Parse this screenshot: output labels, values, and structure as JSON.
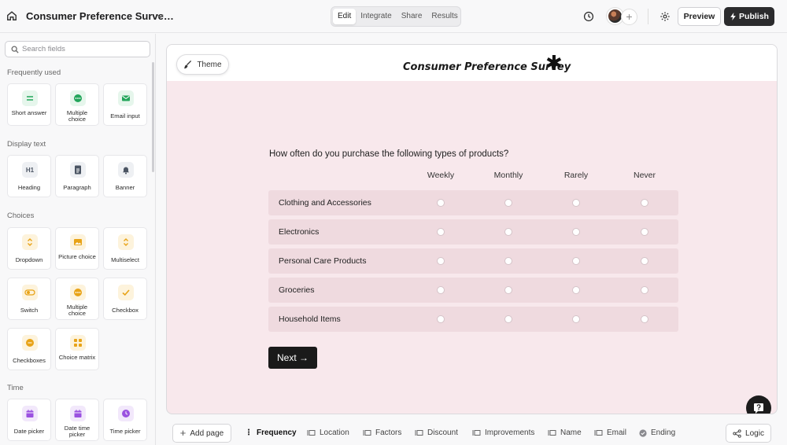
{
  "header": {
    "doc_title": "Consumer Preference Surve…",
    "tabs": [
      {
        "label": "Edit",
        "active": true
      },
      {
        "label": "Integrate",
        "active": false
      },
      {
        "label": "Share",
        "active": false
      },
      {
        "label": "Results",
        "active": false
      }
    ],
    "preview_label": "Preview",
    "publish_label": "Publish",
    "add_collaborator": "+"
  },
  "sidebar": {
    "search_placeholder": "Search fields",
    "sections": [
      {
        "label": "Frequently used",
        "items": [
          {
            "label": "Short answer",
            "icon": "short-answer-icon",
            "color": "#22a55a"
          },
          {
            "label": "Multiple choice",
            "icon": "multiple-choice-icon",
            "color": "#22a55a"
          },
          {
            "label": "Email input",
            "icon": "email-icon",
            "color": "#22a55a"
          }
        ]
      },
      {
        "label": "Display text",
        "items": [
          {
            "label": "Heading",
            "icon": "heading-icon",
            "color": "#4b5563"
          },
          {
            "label": "Paragraph",
            "icon": "paragraph-icon",
            "color": "#4b5563"
          },
          {
            "label": "Banner",
            "icon": "bell-icon",
            "color": "#4b5563"
          }
        ]
      },
      {
        "label": "Choices",
        "items": [
          {
            "label": "Dropdown",
            "icon": "dropdown-icon",
            "color": "#e8a317"
          },
          {
            "label": "Picture choice",
            "icon": "picture-icon",
            "color": "#e8a317"
          },
          {
            "label": "Multiselect",
            "icon": "multiselect-icon",
            "color": "#e8a317"
          },
          {
            "label": "Switch",
            "icon": "switch-icon",
            "color": "#e8a317"
          },
          {
            "label": "Multiple choice",
            "icon": "multiple-choice-icon",
            "color": "#e8a317"
          },
          {
            "label": "Checkbox",
            "icon": "checkbox-icon",
            "color": "#e8a317"
          },
          {
            "label": "Checkboxes",
            "icon": "checkboxes-icon",
            "color": "#e8a317"
          },
          {
            "label": "Choice matrix",
            "icon": "grid-icon",
            "color": "#e8a317"
          }
        ]
      },
      {
        "label": "Time",
        "items": [
          {
            "label": "Date picker",
            "icon": "calendar-icon",
            "color": "#9b51e0"
          },
          {
            "label": "Date time picker",
            "icon": "calendar-icon",
            "color": "#9b51e0"
          },
          {
            "label": "Time picker",
            "icon": "clock-icon",
            "color": "#9b51e0"
          }
        ]
      }
    ]
  },
  "canvas": {
    "theme_label": "Theme",
    "survey_title": "Consumer Preference Survey",
    "logo": "✱",
    "question": "How often do you purchase the following types of products?",
    "columns": [
      "Weekly",
      "Monthly",
      "Rarely",
      "Never"
    ],
    "rows": [
      "Clothing and Accessories",
      "Electronics",
      "Personal Care Products",
      "Groceries",
      "Household Items"
    ],
    "next_label": "Next →",
    "background_color": "#f8e8ec"
  },
  "bottom_bar": {
    "add_page_label": "Add page",
    "pages": [
      {
        "label": "Frequency",
        "active": true
      },
      {
        "label": "Location",
        "active": false
      },
      {
        "label": "Factors",
        "active": false
      },
      {
        "label": "Discount",
        "active": false
      },
      {
        "label": "Improvements",
        "active": false
      },
      {
        "label": "Name",
        "active": false
      },
      {
        "label": "Email",
        "active": false
      },
      {
        "label": "Ending",
        "active": false
      }
    ],
    "logic_label": "Logic"
  }
}
